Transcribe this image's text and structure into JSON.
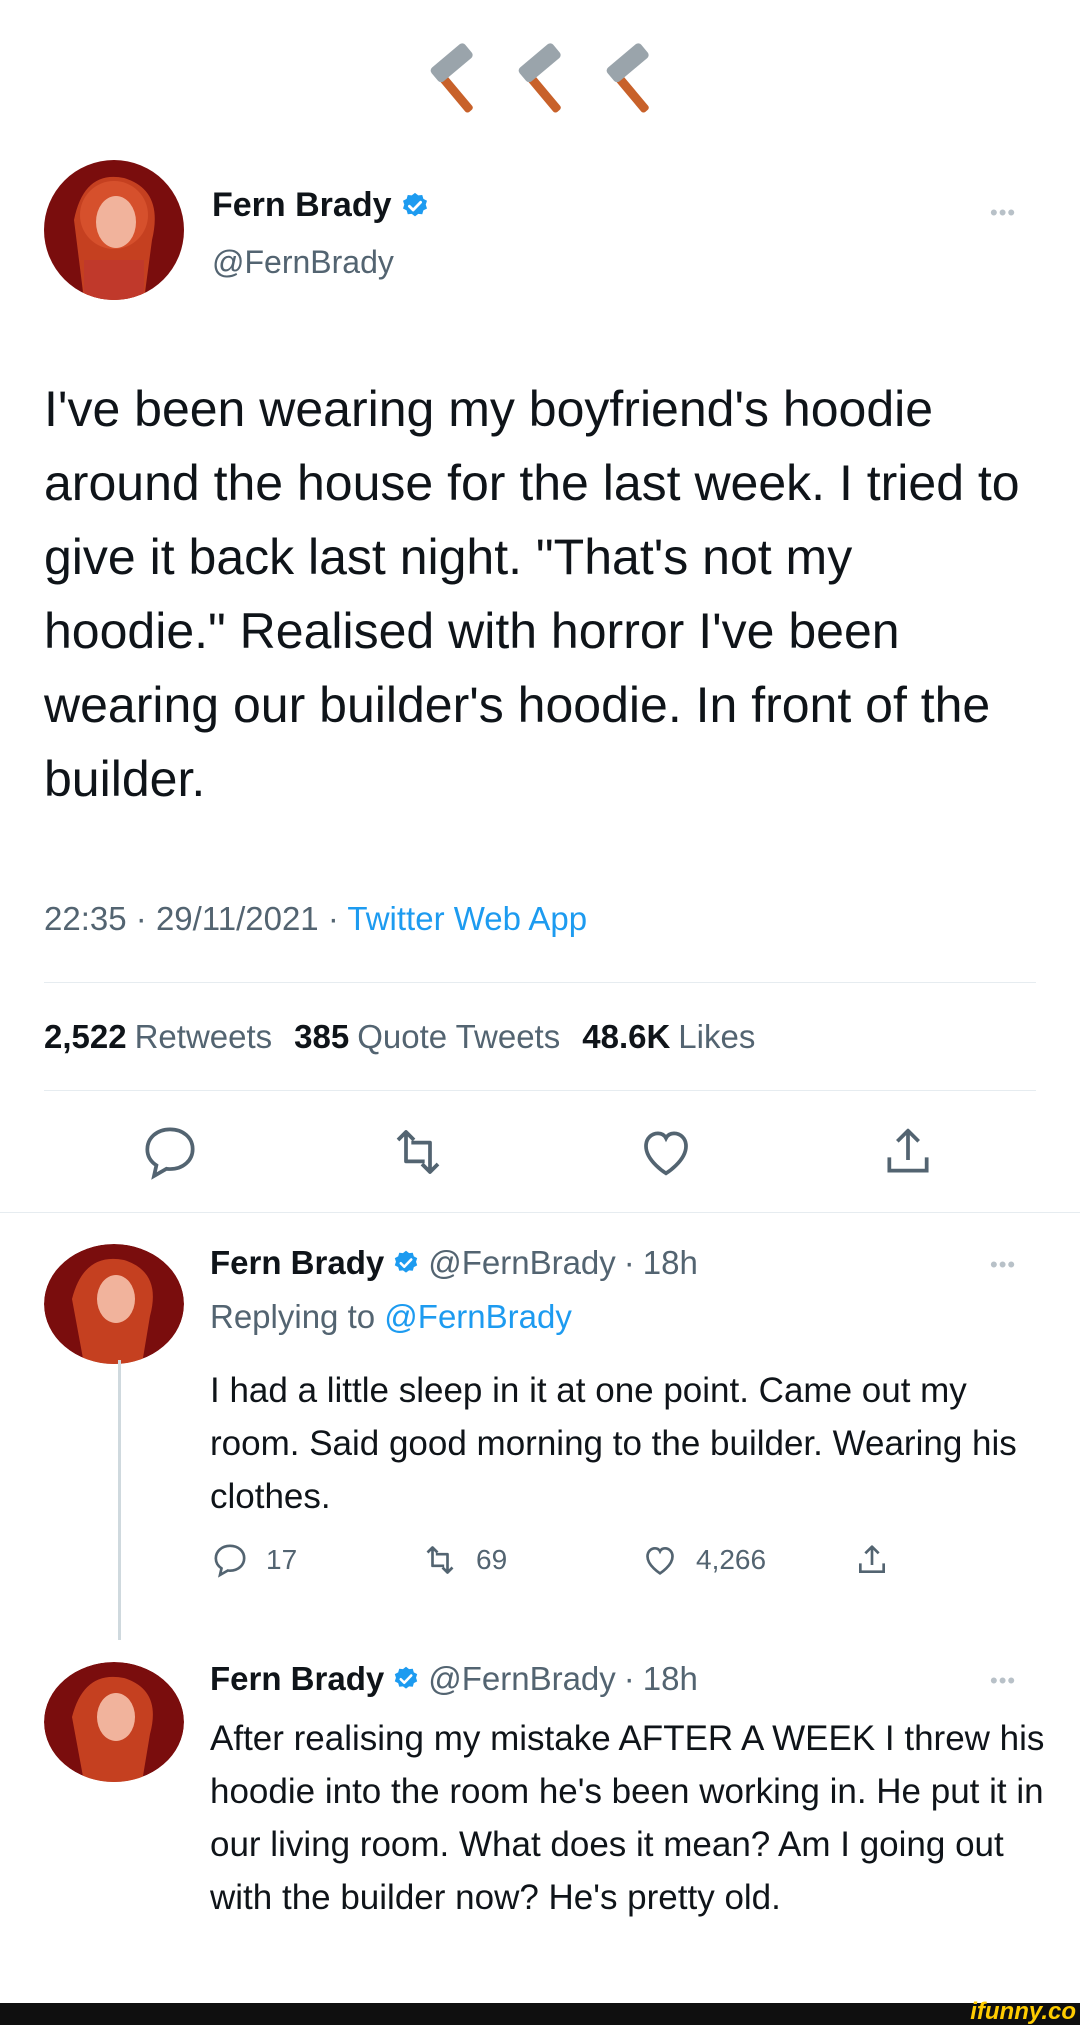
{
  "header_emoji": [
    "hammer",
    "hammer",
    "hammer"
  ],
  "main_tweet": {
    "name": "Fern Brady",
    "handle": "@FernBrady",
    "text": "I've been wearing my boyfriend's hoodie around the house for the last week. I tried to give it back last night. \"That's not my hoodie.\" Realised with horror I've been wearing our builder's hoodie. In front of the builder.",
    "time": "22:35",
    "date": "29/11/2021",
    "source": "Twitter Web App",
    "retweets_count": "2,522",
    "retweets_label": "Retweets",
    "quotes_count": "385",
    "quotes_label": "Quote Tweets",
    "likes_count": "48.6K",
    "likes_label": "Likes"
  },
  "replies": [
    {
      "name": "Fern Brady",
      "handle": "@FernBrady",
      "age": "18h",
      "replying_prefix": "Replying to",
      "replying_to": "@FernBrady",
      "text": "I had a little sleep in it at one point. Came out my room. Said good morning to the builder. Wearing his clothes.",
      "replies_count": "17",
      "retweets_count": "69",
      "likes_count": "4,266"
    },
    {
      "name": "Fern Brady",
      "handle": "@FernBrady",
      "age": "18h",
      "text": "After realising my mistake AFTER A WEEK I threw his hoodie into the room he's been working in. He put it in our living room. What does it mean? Am I going out with the builder now? He's pretty old."
    }
  ],
  "watermark": "ifunny.co",
  "colors": {
    "accent": "#1d9bf0",
    "muted": "#536471",
    "text": "#0f1419"
  }
}
